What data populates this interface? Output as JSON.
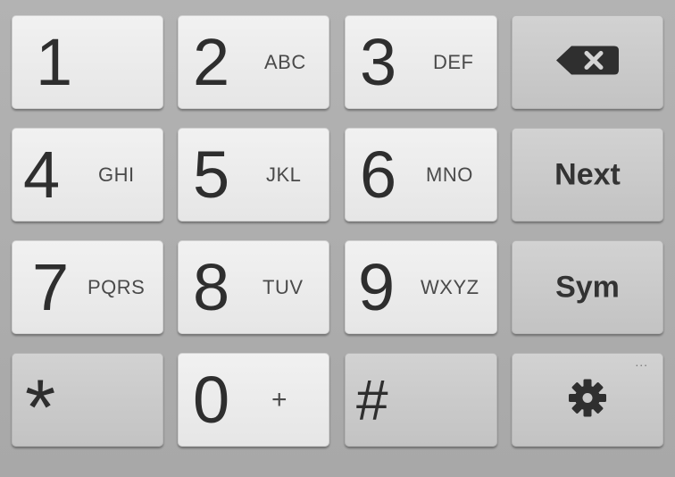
{
  "keypad": {
    "keys": [
      {
        "digit": "1",
        "letters": ""
      },
      {
        "digit": "2",
        "letters": "ABC"
      },
      {
        "digit": "3",
        "letters": "DEF"
      },
      {
        "digit": "4",
        "letters": "GHI"
      },
      {
        "digit": "5",
        "letters": "JKL"
      },
      {
        "digit": "6",
        "letters": "MNO"
      },
      {
        "digit": "7",
        "letters": "PQRS"
      },
      {
        "digit": "8",
        "letters": "TUV"
      },
      {
        "digit": "9",
        "letters": "WXYZ"
      },
      {
        "digit": "0",
        "letters": "+"
      }
    ],
    "star_label": "*",
    "hash_label": "#",
    "next_label": "Next",
    "sym_label": "Sym",
    "settings_more": "...",
    "backspace_icon": "backspace-icon",
    "settings_icon": "gear-icon"
  },
  "colors": {
    "background": "#ababab",
    "key_light": "#ececec",
    "key_dark": "#c9c9c9",
    "text": "#2e2e2e"
  }
}
